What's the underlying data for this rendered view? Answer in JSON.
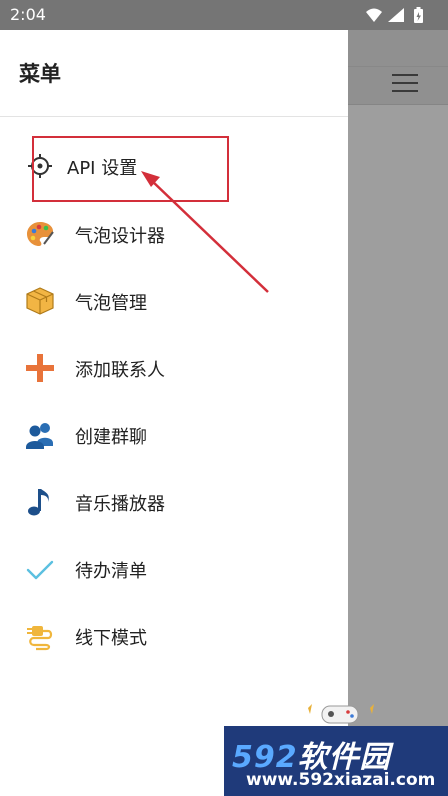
{
  "status_bar": {
    "time": "2:04",
    "icons": [
      "wifi-icon",
      "signal-icon",
      "battery-charging-icon"
    ]
  },
  "drawer": {
    "title": "菜单",
    "items": [
      {
        "label": "API 设置",
        "icon": "gear-icon"
      },
      {
        "label": "气泡设计器",
        "icon": "palette-icon"
      },
      {
        "label": "气泡管理",
        "icon": "box-icon"
      },
      {
        "label": "添加联系人",
        "icon": "plus-icon"
      },
      {
        "label": "创建群聊",
        "icon": "group-icon"
      },
      {
        "label": "音乐播放器",
        "icon": "music-note-icon"
      },
      {
        "label": "待办清单",
        "icon": "checkmark-icon"
      },
      {
        "label": "线下模式",
        "icon": "plug-icon"
      }
    ]
  },
  "app_toolbar": {
    "menu_icon": "hamburger-menu-icon"
  },
  "watermark": {
    "brand_number": "592",
    "brand_text": "软件园",
    "url": "www.592xiazai.com"
  },
  "colors": {
    "annotation": "#d32f3a",
    "drawer_bg": "#ffffff",
    "scrim": "#9e9e9e",
    "status_bar": "#757575"
  }
}
